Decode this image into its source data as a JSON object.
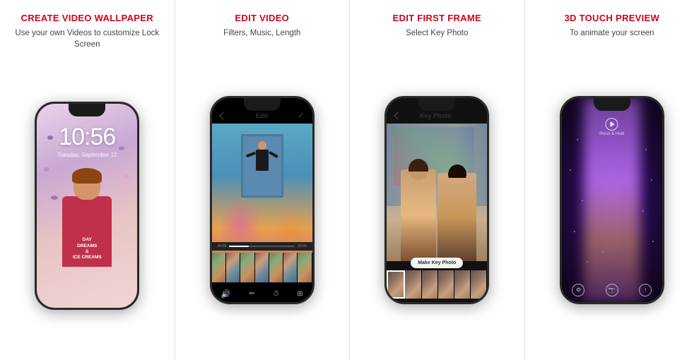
{
  "panels": [
    {
      "id": "panel-1",
      "title": "CREATE VIDEO WALLPAPER",
      "subtitle": "Use your own Videos to\ncustomize Lock Screen",
      "time": "10:56",
      "date": "Tuesday, September 12",
      "phone_content": "child"
    },
    {
      "id": "panel-2",
      "title": "EDIT VIDEO",
      "subtitle": "Filters, Music, Length",
      "header_title": "Edit",
      "phone_content": "edit_video"
    },
    {
      "id": "panel-3",
      "title": "EDIT FIRST FRAME",
      "subtitle": "Select Key Photo",
      "header_title": "Key Photo",
      "button_label": "Make Key Photo",
      "phone_content": "key_photo"
    },
    {
      "id": "panel-4",
      "title": "3D TOUCH PREVIEW",
      "subtitle": "To animate your screen",
      "press_hold": "Press & Hold",
      "phone_content": "3d_touch"
    }
  ],
  "colors": {
    "accent_red": "#d0021b",
    "dark_bg": "#1a1a1a",
    "panel_border": "#e0e0e0"
  }
}
